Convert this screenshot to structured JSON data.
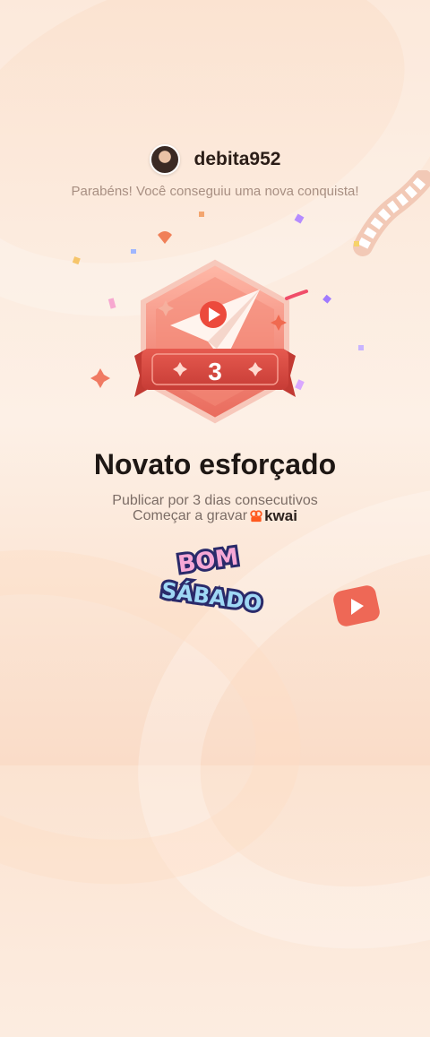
{
  "header": {
    "username": "debita952"
  },
  "congrats_text": "Parabéns! Você conseguiu uma nova conquista!",
  "badge": {
    "level": "3",
    "icon": "play-button-icon"
  },
  "achievement": {
    "title": "Novato esforçado",
    "description": "Publicar por 3 dias consecutivos",
    "cta_label": "Começar a gravar",
    "brand_name": "kwai"
  },
  "sticker": {
    "line1": "BOM",
    "line2": "SÁBADO"
  },
  "colors": {
    "badge_red": "#e0524a",
    "brand_orange": "#ff5a1f"
  }
}
